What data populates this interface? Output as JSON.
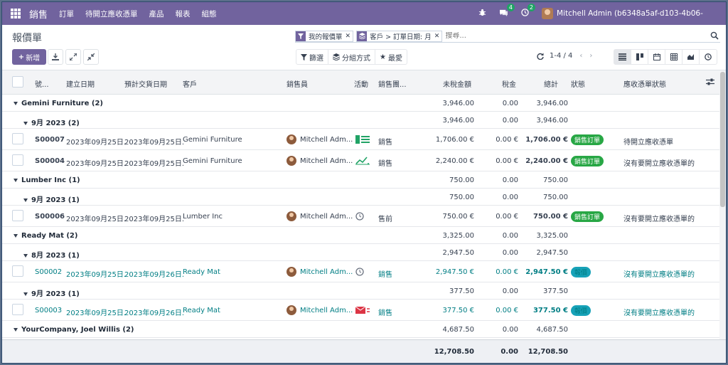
{
  "navbar": {
    "app_name": "銷售",
    "menu": [
      "訂單",
      "待開立應收憑單",
      "產品",
      "報表",
      "組態"
    ],
    "chat_count": "4",
    "activity_count": "2",
    "user": "Mitchell Admin (b6348a5af-d103-4b06-"
  },
  "control": {
    "title": "報價單",
    "new_label": "新增",
    "facets": [
      {
        "icon": "filter-icon",
        "label": "我的報價單"
      },
      {
        "icon": "layers-icon",
        "label": "客戶 > 訂單日期: 月"
      }
    ],
    "search_placeholder": "搜尋...",
    "filters_label": "篩選",
    "groupby_label": "分組方式",
    "favorites_label": "最愛",
    "pager": "1-4 / 4"
  },
  "columns": {
    "number": "號...",
    "created": "建立日期",
    "expected": "預計交貨日期",
    "customer": "客戶",
    "salesperson": "銷售員",
    "activity": "活動",
    "team": "銷售團...",
    "untaxed": "未稅金額",
    "tax": "稅金",
    "total": "總計",
    "status": "狀態",
    "invoice_status": "應收憑單狀態"
  },
  "rows": [
    {
      "type": "group",
      "label": "Gemini Furniture (2)",
      "untaxed": "3,946.00",
      "tax": "0.00",
      "total": "3,946.00"
    },
    {
      "type": "group2",
      "label": "9月 2023 (2)",
      "untaxed": "3,946.00",
      "tax": "0.00",
      "total": "3,946.00"
    },
    {
      "type": "rec",
      "link": false,
      "number": "S00007",
      "created": "2023年09月25日.",
      "expected": "2023年09月25日.",
      "customer": "Gemini Furniture",
      "salesperson": "Mitchell Adm...",
      "activity_icon": "phone-list-icon",
      "activity_color": "#21a366",
      "team": "銷售",
      "untaxed": "1,706.00 €",
      "tax": "0.00 €",
      "total": "1,706.00 €",
      "status": "銷售訂單",
      "status_color": "green",
      "invoice": "待開立應收憑單"
    },
    {
      "type": "rec",
      "link": false,
      "number": "S00004",
      "created": "2023年09月25日.",
      "expected": "2023年09月25日.",
      "customer": "Gemini Furniture",
      "salesperson": "Mitchell Adm...",
      "activity_icon": "chart-line-icon",
      "activity_color": "#21a366",
      "team": "銷售",
      "untaxed": "2,240.00 €",
      "tax": "0.00 €",
      "total": "2,240.00 €",
      "status": "銷售訂單",
      "status_color": "green",
      "invoice": "沒有要開立應收憑單的"
    },
    {
      "type": "group",
      "label": "Lumber Inc (1)",
      "untaxed": "750.00",
      "tax": "0.00",
      "total": "750.00"
    },
    {
      "type": "group2",
      "label": "9月 2023 (1)",
      "untaxed": "750.00",
      "tax": "0.00",
      "total": "750.00"
    },
    {
      "type": "rec",
      "link": false,
      "number": "S00006",
      "created": "2023年09月25日.",
      "expected": "2023年09月25日.",
      "customer": "Lumber Inc",
      "salesperson": "Mitchell Adm...",
      "activity_icon": "clock-icon",
      "activity_color": "#6b7280",
      "team": "售前",
      "untaxed": "750.00 €",
      "tax": "0.00 €",
      "total": "750.00 €",
      "status": "銷售訂單",
      "status_color": "green",
      "invoice": "沒有要開立應收憑單的"
    },
    {
      "type": "group",
      "label": "Ready Mat (2)",
      "untaxed": "3,325.00",
      "tax": "0.00",
      "total": "3,325.00"
    },
    {
      "type": "group2",
      "label": "8月 2023 (1)",
      "untaxed": "2,947.50",
      "tax": "0.00",
      "total": "2,947.50"
    },
    {
      "type": "rec",
      "link": true,
      "number": "S00002",
      "created": "2023年09月25日.",
      "expected": "2023年09月26日.",
      "customer": "Ready Mat",
      "salesperson": "Mitchell Adm...",
      "activity_icon": "clock-icon",
      "activity_color": "#6b7280",
      "team": "銷售",
      "untaxed": "2,947.50 €",
      "tax": "0.00 €",
      "total": "2,947.50 €",
      "status": "報價",
      "status_color": "blue",
      "invoice": "沒有要開立應收憑單的"
    },
    {
      "type": "group2",
      "label": "9月 2023 (1)",
      "untaxed": "377.50",
      "tax": "0.00",
      "total": "377.50"
    },
    {
      "type": "rec",
      "link": true,
      "number": "S00003",
      "created": "2023年09月25日.",
      "expected": "2023年09月26日.",
      "customer": "Ready Mat",
      "salesperson": "Mitchell Adm...",
      "activity_icon": "envelope-icon",
      "activity_color": "#dc3545",
      "team": "銷售",
      "untaxed": "377.50 €",
      "tax": "0.00 €",
      "total": "377.50 €",
      "status": "報價",
      "status_color": "blue",
      "invoice": "沒有要開立應收憑單的"
    },
    {
      "type": "group",
      "label": "YourCompany, Joel Willis (2)",
      "untaxed": "4,687.50",
      "tax": "0.00",
      "total": "4,687.50"
    }
  ],
  "totals": {
    "untaxed": "12,708.50",
    "tax": "0.00",
    "total": "12,708.50"
  }
}
